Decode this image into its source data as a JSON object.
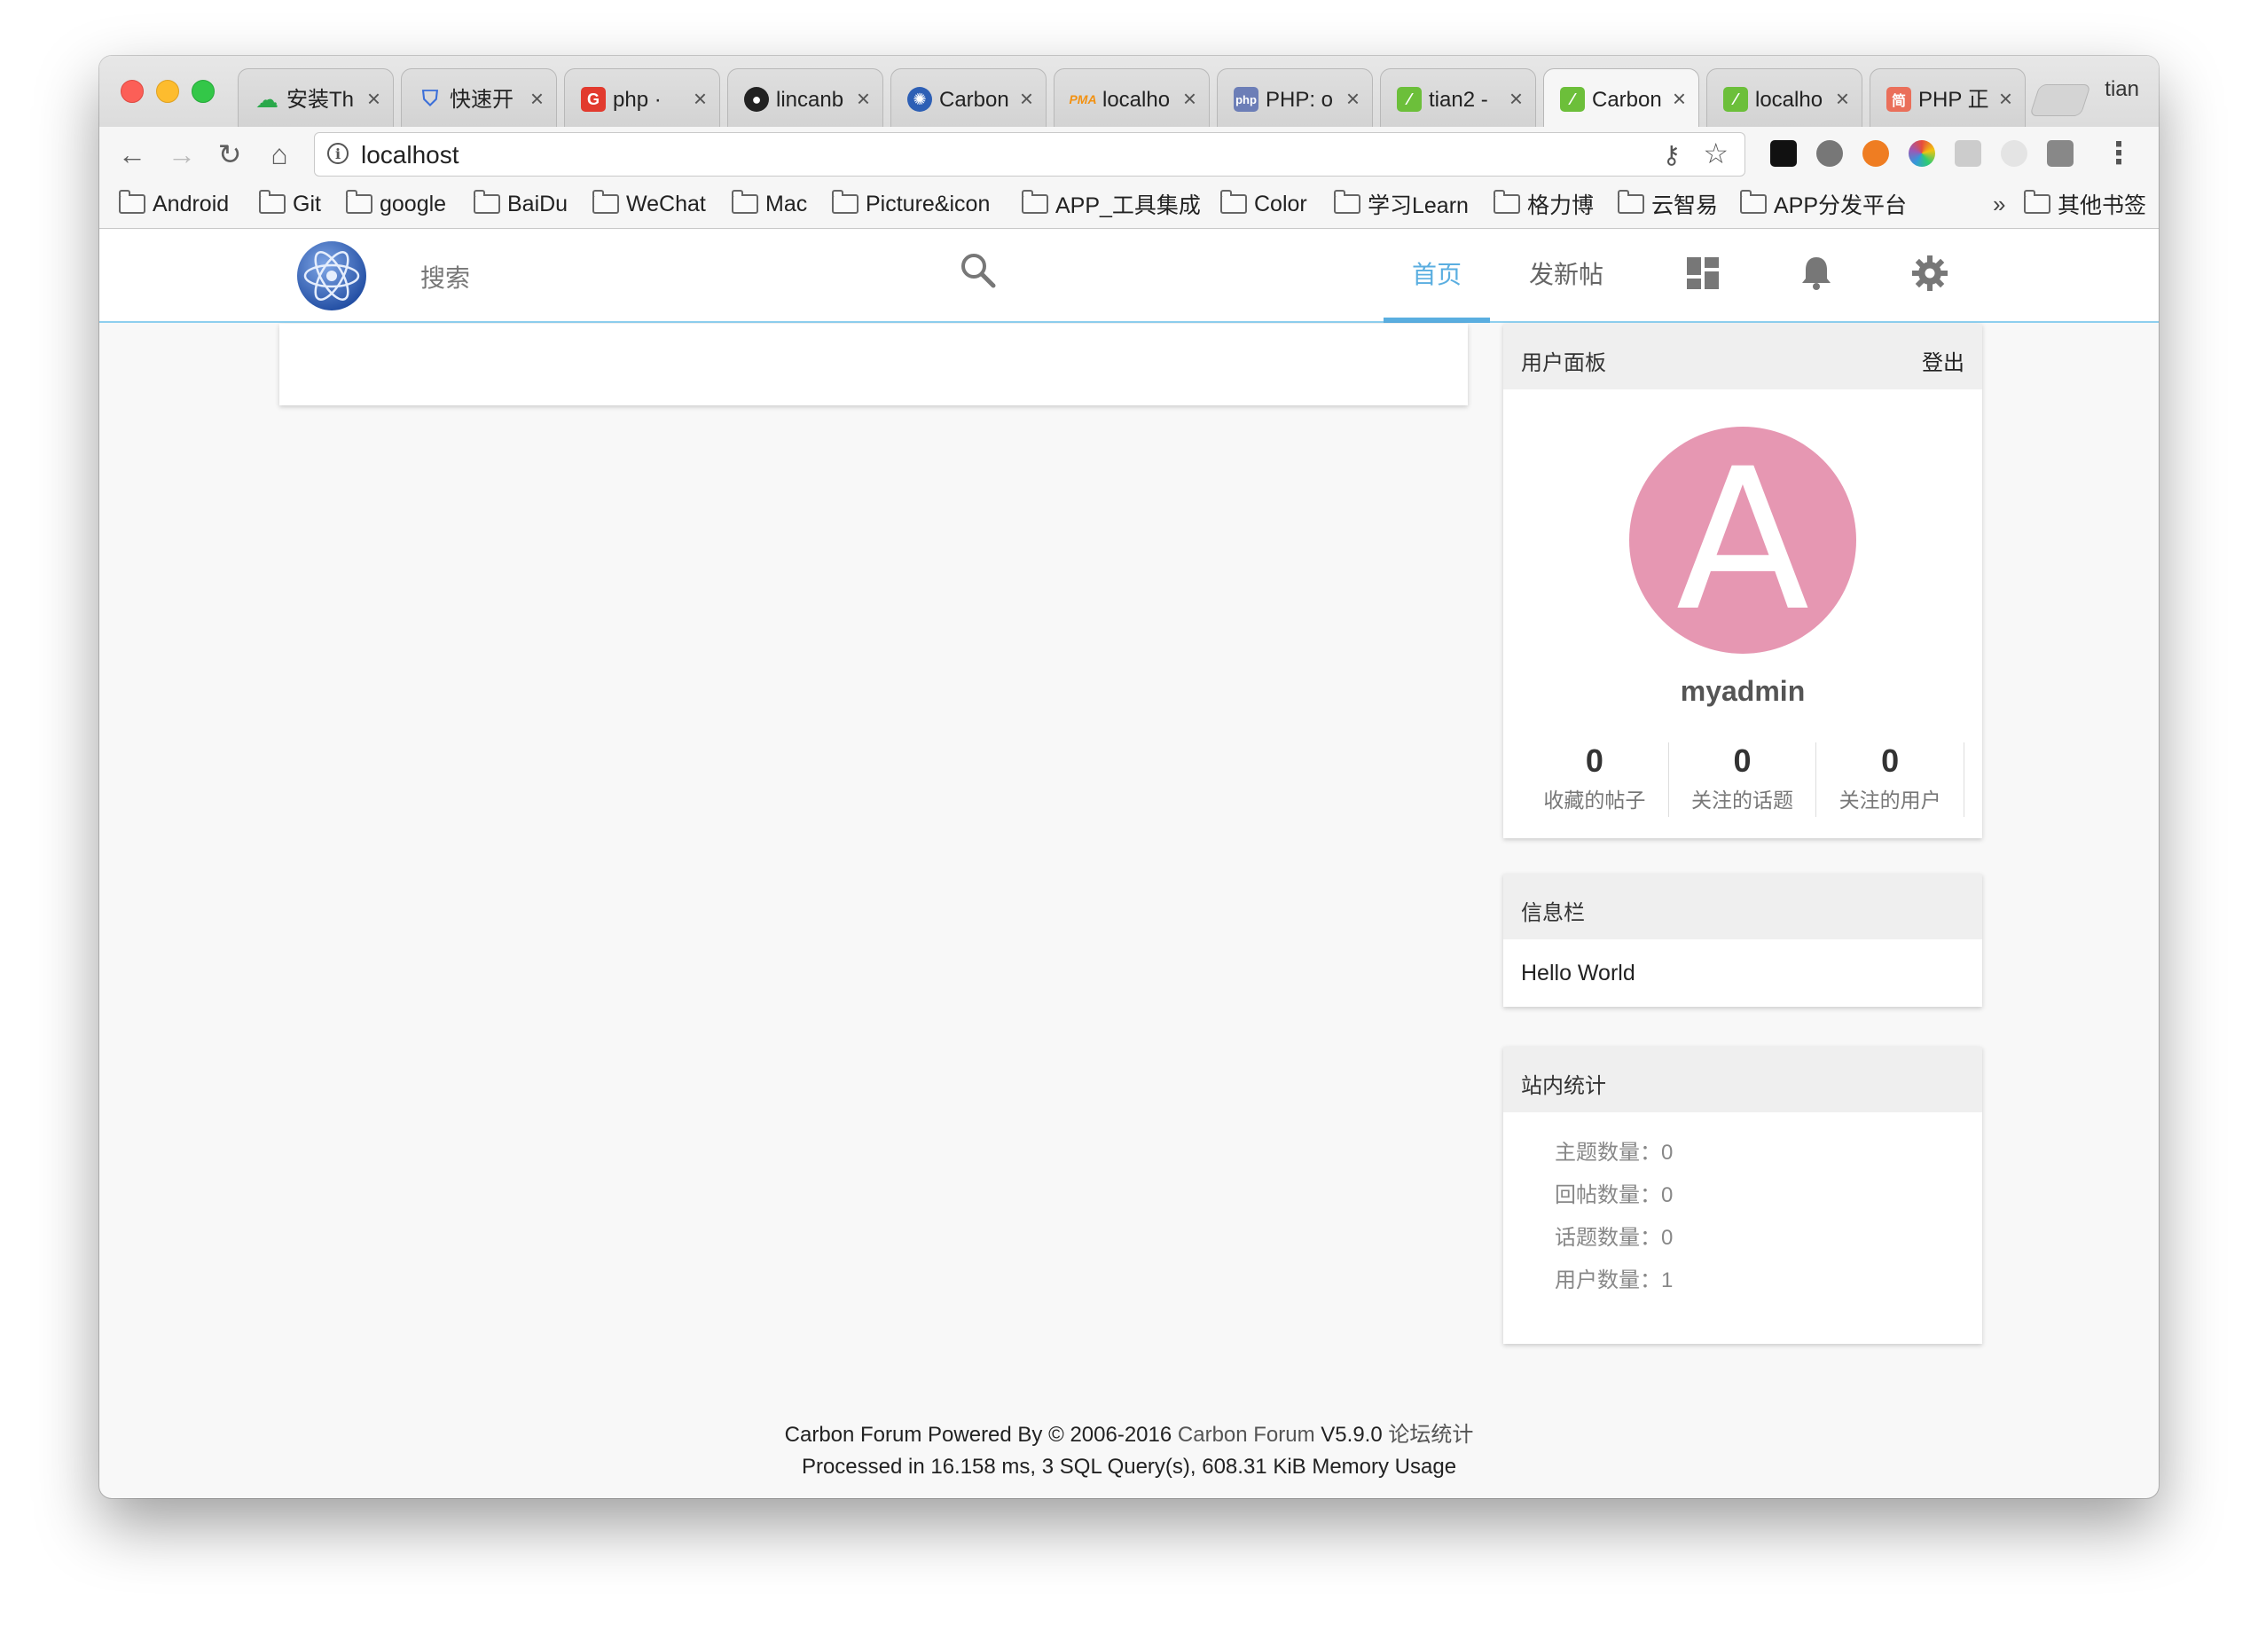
{
  "browser": {
    "tabs": [
      {
        "title": "安装Th",
        "favicon": "cloud-icon",
        "color": "#2aa84a"
      },
      {
        "title": "快速开",
        "favicon": "shield-icon",
        "color": "#3b6fd9"
      },
      {
        "title": "php · ",
        "favicon": "g-logo-icon",
        "color": "#e23a2e"
      },
      {
        "title": "lincanb",
        "favicon": "github-icon",
        "color": "#222222"
      },
      {
        "title": "Carbon",
        "favicon": "carbon-logo-icon",
        "color": "#2d5fb5"
      },
      {
        "title": "localho",
        "favicon": "phpmyadmin-icon",
        "color": "#f29111"
      },
      {
        "title": "PHP: o",
        "favicon": "php-icon",
        "color": "#6c7eb7"
      },
      {
        "title": "tian2 -",
        "favicon": "leaf-icon",
        "color": "#6cbf3a"
      },
      {
        "title": "Carbon",
        "favicon": "leaf-icon",
        "color": "#6cbf3a",
        "active": true
      },
      {
        "title": "localho",
        "favicon": "leaf-icon",
        "color": "#6cbf3a"
      },
      {
        "title": "PHP 正",
        "favicon": "jianshu-icon",
        "color": "#ea6f5a"
      }
    ],
    "profile_name": "tian",
    "url": "localhost",
    "bookmarks": [
      "Android",
      "Git",
      "google",
      "BaiDu",
      "WeChat",
      "Mac",
      "Picture&icon",
      "APP_工具集成",
      "Color",
      "学习Learn",
      "格力博",
      "云智易",
      "APP分发平台"
    ],
    "bookmarks_overflow": "»",
    "other_bookmarks": "其他书签"
  },
  "header": {
    "search_placeholder": "搜索",
    "nav_home": "首页",
    "nav_new_post": "发新帖",
    "accent_color": "#5aaee0"
  },
  "user_panel": {
    "title": "用户面板",
    "logout": "登出",
    "avatar_letter": "A",
    "avatar_color": "#e697b2",
    "username": "myadmin",
    "stats": [
      {
        "value": "0",
        "label": "收藏的帖子"
      },
      {
        "value": "0",
        "label": "关注的话题"
      },
      {
        "value": "0",
        "label": "关注的用户"
      }
    ]
  },
  "info_panel": {
    "title": "信息栏",
    "content": "Hello World"
  },
  "site_stats": {
    "title": "站内统计",
    "rows": [
      "主题数量：0",
      "回帖数量：0",
      "话题数量：0",
      "用户数量：1"
    ]
  },
  "footer": {
    "prefix": "Carbon Forum Powered By © 2006-2016 ",
    "link": "Carbon Forum",
    "version": " V5.9.0 ",
    "stats_link": "论坛统计",
    "line2": "Processed in 16.158 ms, 3 SQL Query(s), 608.31 KiB Memory Usage"
  }
}
